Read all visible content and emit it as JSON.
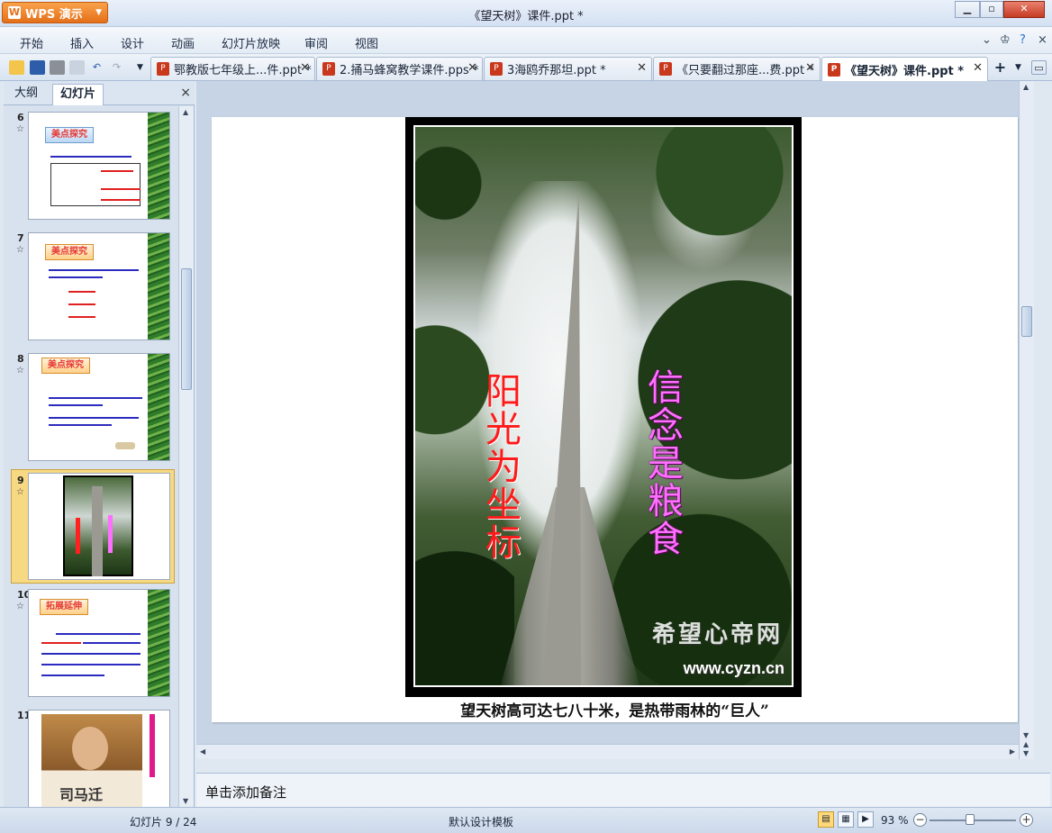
{
  "app": {
    "brand": "WPS 演示",
    "window_title": "《望天树》课件.ppt *"
  },
  "menu": {
    "items": [
      "开始",
      "插入",
      "设计",
      "动画",
      "幻灯片放映",
      "审阅",
      "视图"
    ]
  },
  "tabs": [
    {
      "label": "鄂教版七年级上...件.ppt *"
    },
    {
      "label": "2.捅马蜂窝教学课件.pps *"
    },
    {
      "label": "3海鸥乔那坦.ppt *"
    },
    {
      "label": "《只要翻过那座...费.ppt *"
    },
    {
      "label": "《望天树》课件.ppt *"
    }
  ],
  "side_panel": {
    "tab_outline": "大纲",
    "tab_slides": "幻灯片",
    "close": "×",
    "slides": [
      {
        "num": "6",
        "banner": "美点探究",
        "banner_style": "blue"
      },
      {
        "num": "7",
        "banner": "美点探究",
        "banner_style": "orange"
      },
      {
        "num": "8",
        "banner": "美点探究",
        "banner_style": "orange"
      },
      {
        "num": "9",
        "selected": true
      },
      {
        "num": "10",
        "banner": "拓展延伸",
        "banner_style": "orange"
      },
      {
        "num": "11",
        "name_text": "司马迁"
      }
    ]
  },
  "slide": {
    "left_text": "阳光为坐标",
    "right_text": "信念是粮食",
    "watermark": "希望心帝网",
    "watermark_url": "www.cyzn.cn",
    "caption": "望天树高可达七八十米，是热带雨林的“巨人”"
  },
  "notes": {
    "placeholder": "单击添加备注"
  },
  "status": {
    "slide_info": "幻灯片 9 / 24",
    "template": "默认设计模板",
    "zoom": "93 %"
  },
  "colors": {
    "brand_orange": "#e4701a",
    "title_red": "#ff1a1a",
    "title_pink": "#ff6fff",
    "selection": "#f7d984"
  }
}
